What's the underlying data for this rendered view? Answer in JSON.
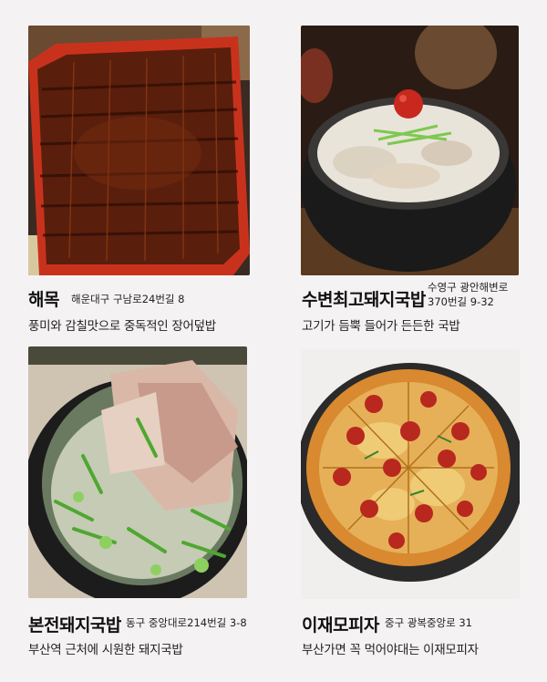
{
  "restaurants": [
    {
      "name": "해목",
      "address": "해운대구 구남로24번길 8",
      "description": "풍미와 감칠맛으로 중독적인 장어덮밥",
      "photo_icon": "eel-rice-bowl-photo"
    },
    {
      "name": "수변최고돼지국밥",
      "address_line1": "수영구 광안해변로",
      "address_line2": "370번길 9-32",
      "description": "고기가 듬뿍 들어가 든든한 국밥",
      "photo_icon": "pork-soup-stone-bowl-photo"
    },
    {
      "name": "본전돼지국밥",
      "address": "동구 중앙대로214번길 3-8",
      "description": "부산역 근처에 시원한 돼지국밥",
      "photo_icon": "pork-soup-green-onion-photo"
    },
    {
      "name": "이재모피자",
      "address": "중구 광복중앙로 31",
      "description": "부산가면 꼭 먹어야대는 이재모피자",
      "photo_icon": "pepperoni-pizza-photo"
    }
  ],
  "colors": {
    "background": "#f4f2f3",
    "lacquer_box": "#c8321c",
    "eel_glaze": "#5a1e0c",
    "broth": "#e9e4da",
    "pizza_crust": "#d9892f",
    "pepperoni": "#b8281e"
  }
}
